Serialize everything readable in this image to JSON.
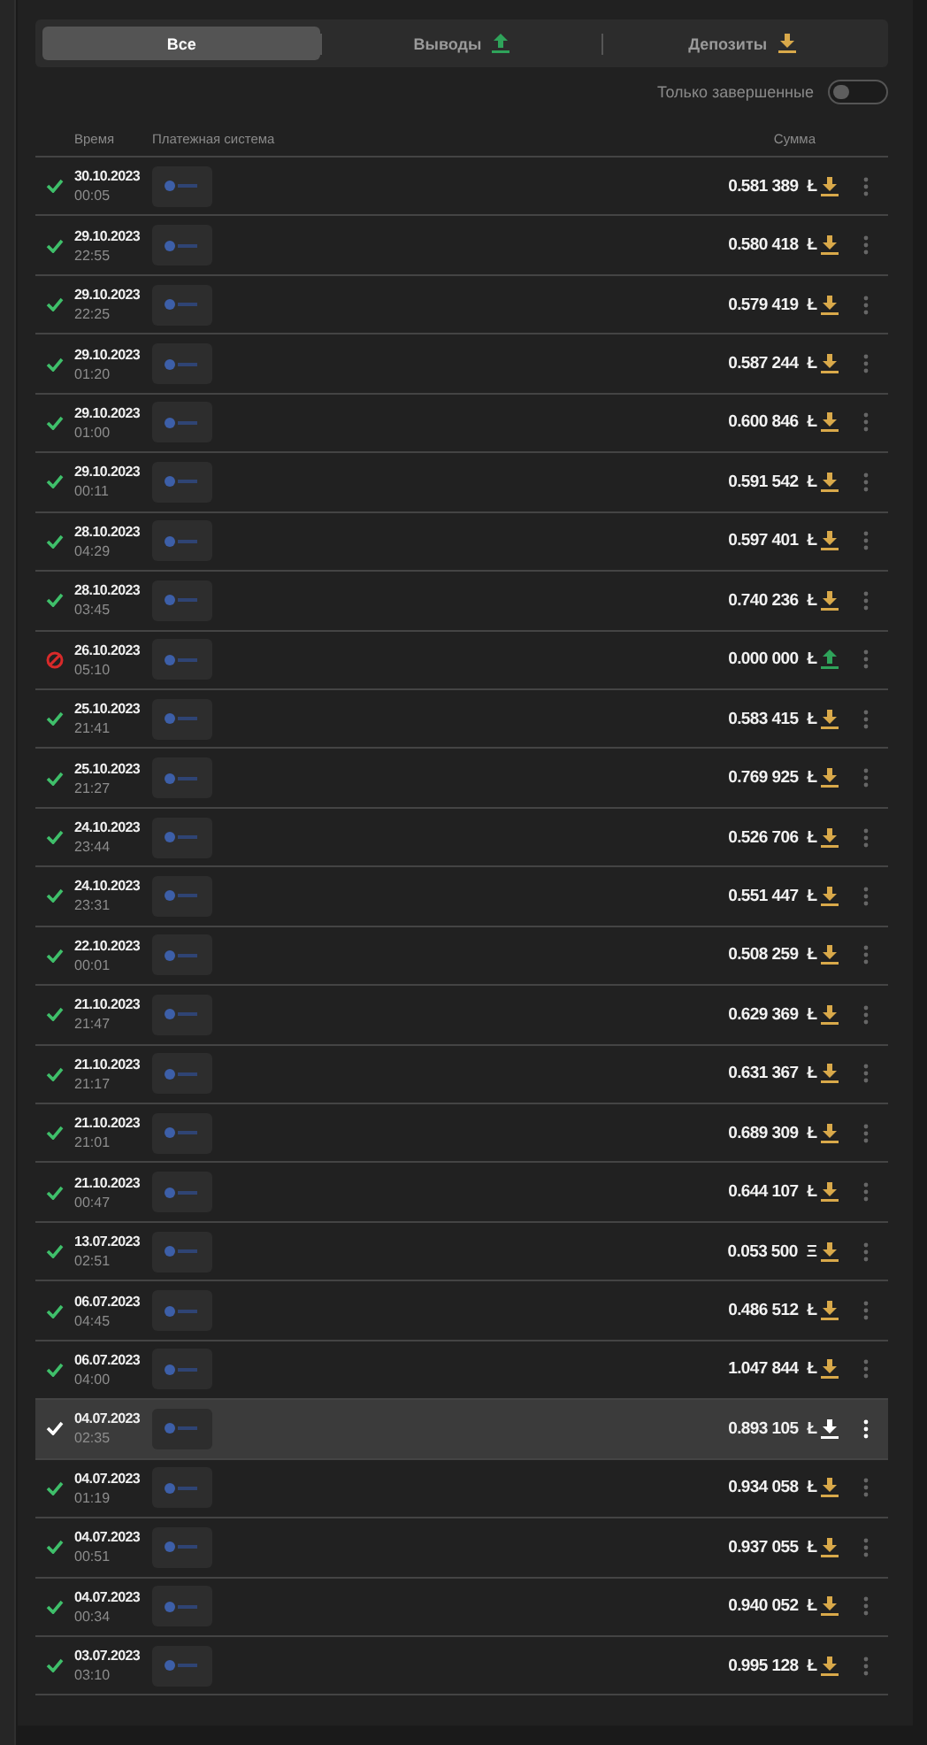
{
  "tabs": [
    {
      "label": "Все",
      "selected": true
    },
    {
      "label": "Выводы",
      "selected": false,
      "kind": "withdrawal"
    },
    {
      "label": "Депозиты",
      "selected": false,
      "kind": "deposit"
    }
  ],
  "filter": {
    "label": "Только завершенные",
    "on": false
  },
  "table": {
    "columns": [
      "Время",
      "Платежная система",
      "Сумма"
    ],
    "rows": [
      {
        "failed": false,
        "date": "30.10.2023",
        "time": "00:05",
        "amount": "0.581 389",
        "currency": "Ł",
        "kind": "deposit",
        "selected": false
      },
      {
        "failed": false,
        "date": "29.10.2023",
        "time": "22:55",
        "amount": "0.580 418",
        "currency": "Ł",
        "kind": "deposit",
        "selected": false
      },
      {
        "failed": false,
        "date": "29.10.2023",
        "time": "22:25",
        "amount": "0.579 419",
        "currency": "Ł",
        "kind": "deposit",
        "selected": false
      },
      {
        "failed": false,
        "date": "29.10.2023",
        "time": "01:20",
        "amount": "0.587 244",
        "currency": "Ł",
        "kind": "deposit",
        "selected": false
      },
      {
        "failed": false,
        "date": "29.10.2023",
        "time": "01:00",
        "amount": "0.600 846",
        "currency": "Ł",
        "kind": "deposit",
        "selected": false
      },
      {
        "failed": false,
        "date": "29.10.2023",
        "time": "00:11",
        "amount": "0.591 542",
        "currency": "Ł",
        "kind": "deposit",
        "selected": false
      },
      {
        "failed": false,
        "date": "28.10.2023",
        "time": "04:29",
        "amount": "0.597 401",
        "currency": "Ł",
        "kind": "deposit",
        "selected": false
      },
      {
        "failed": false,
        "date": "28.10.2023",
        "time": "03:45",
        "amount": "0.740 236",
        "currency": "Ł",
        "kind": "deposit",
        "selected": false
      },
      {
        "failed": true,
        "date": "26.10.2023",
        "time": "05:10",
        "amount": "0.000 000",
        "currency": "Ł",
        "kind": "withdrawal",
        "selected": false
      },
      {
        "failed": false,
        "date": "25.10.2023",
        "time": "21:41",
        "amount": "0.583 415",
        "currency": "Ł",
        "kind": "deposit",
        "selected": false
      },
      {
        "failed": false,
        "date": "25.10.2023",
        "time": "21:27",
        "amount": "0.769 925",
        "currency": "Ł",
        "kind": "deposit",
        "selected": false
      },
      {
        "failed": false,
        "date": "24.10.2023",
        "time": "23:44",
        "amount": "0.526 706",
        "currency": "Ł",
        "kind": "deposit",
        "selected": false
      },
      {
        "failed": false,
        "date": "24.10.2023",
        "time": "23:31",
        "amount": "0.551 447",
        "currency": "Ł",
        "kind": "deposit",
        "selected": false
      },
      {
        "failed": false,
        "date": "22.10.2023",
        "time": "00:01",
        "amount": "0.508 259",
        "currency": "Ł",
        "kind": "deposit",
        "selected": false
      },
      {
        "failed": false,
        "date": "21.10.2023",
        "time": "21:47",
        "amount": "0.629 369",
        "currency": "Ł",
        "kind": "deposit",
        "selected": false
      },
      {
        "failed": false,
        "date": "21.10.2023",
        "time": "21:17",
        "amount": "0.631 367",
        "currency": "Ł",
        "kind": "deposit",
        "selected": false
      },
      {
        "failed": false,
        "date": "21.10.2023",
        "time": "21:01",
        "amount": "0.689 309",
        "currency": "Ł",
        "kind": "deposit",
        "selected": false
      },
      {
        "failed": false,
        "date": "21.10.2023",
        "time": "00:47",
        "amount": "0.644 107",
        "currency": "Ł",
        "kind": "deposit",
        "selected": false
      },
      {
        "failed": false,
        "date": "13.07.2023",
        "time": "02:51",
        "amount": "0.053 500",
        "currency": "Ξ",
        "kind": "deposit",
        "selected": false
      },
      {
        "failed": false,
        "date": "06.07.2023",
        "time": "04:45",
        "amount": "0.486 512",
        "currency": "Ł",
        "kind": "deposit",
        "selected": false
      },
      {
        "failed": false,
        "date": "06.07.2023",
        "time": "04:00",
        "amount": "1.047 844",
        "currency": "Ł",
        "kind": "deposit",
        "selected": false
      },
      {
        "failed": false,
        "date": "04.07.2023",
        "time": "02:35",
        "amount": "0.893 105",
        "currency": "Ł",
        "kind": "deposit",
        "selected": true
      },
      {
        "failed": false,
        "date": "04.07.2023",
        "time": "01:19",
        "amount": "0.934 058",
        "currency": "Ł",
        "kind": "deposit",
        "selected": false
      },
      {
        "failed": false,
        "date": "04.07.2023",
        "time": "00:51",
        "amount": "0.937 055",
        "currency": "Ł",
        "kind": "deposit",
        "selected": false
      },
      {
        "failed": false,
        "date": "04.07.2023",
        "time": "00:34",
        "amount": "0.940 052",
        "currency": "Ł",
        "kind": "deposit",
        "selected": false
      },
      {
        "failed": false,
        "date": "03.07.2023",
        "time": "03:10",
        "amount": "0.995 128",
        "currency": "Ł",
        "kind": "deposit",
        "selected": false
      }
    ]
  }
}
